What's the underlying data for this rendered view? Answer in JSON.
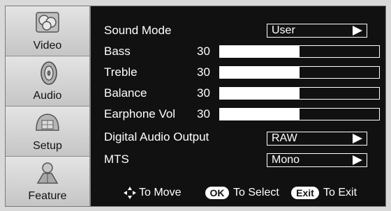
{
  "sidebar": {
    "items": [
      {
        "label": "Video",
        "icon": "video-icon"
      },
      {
        "label": "Audio",
        "icon": "speaker-icon"
      },
      {
        "label": "Setup",
        "icon": "setup-icon"
      },
      {
        "label": "Feature",
        "icon": "feature-icon"
      }
    ],
    "selected": "Audio"
  },
  "menu": {
    "sound_mode": {
      "label": "Sound Mode",
      "value": "User"
    },
    "bass": {
      "label": "Bass",
      "value": "30",
      "level_percent": 50
    },
    "treble": {
      "label": "Treble",
      "value": "30",
      "level_percent": 50
    },
    "balance": {
      "label": "Balance",
      "value": "30",
      "level_percent": 50
    },
    "earphone_vol": {
      "label": "Earphone Vol",
      "value": "30",
      "level_percent": 50
    },
    "digital_audio_output": {
      "label": "Digital Audio Output",
      "value": "RAW"
    },
    "mts": {
      "label": "MTS",
      "value": "Mono"
    }
  },
  "footer": {
    "move_text": "To Move",
    "ok_key": "OK",
    "select_text": "To Select",
    "exit_key": "Exit",
    "exit_text": "To Exit"
  }
}
